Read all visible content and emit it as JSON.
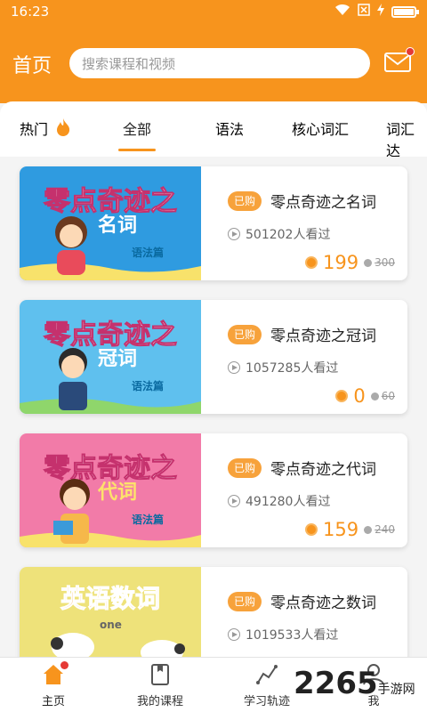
{
  "status_bar": {
    "time": "16:23"
  },
  "header": {
    "title": "首页",
    "search_placeholder": "搜索课程和视频"
  },
  "tabs": [
    {
      "label": "热门",
      "flame": true
    },
    {
      "label": "全部",
      "active": true
    },
    {
      "label": "语法"
    },
    {
      "label": "核心词汇"
    },
    {
      "label": "词汇达"
    }
  ],
  "courses": [
    {
      "badge": "已购",
      "title": "零点奇迹之名词",
      "views": "501202人看过",
      "price": "199",
      "old_price": "300",
      "thumb": {
        "title": "零点奇迹之",
        "subtitle": "名词",
        "tag": "语法篇",
        "bg": "#2f9be0"
      }
    },
    {
      "badge": "已购",
      "title": "零点奇迹之冠词",
      "views": "1057285人看过",
      "price": "0",
      "old_price": "60",
      "thumb": {
        "title": "零点奇迹之",
        "subtitle": "冠词",
        "tag": "语法篇",
        "bg": "#5fc0ee"
      }
    },
    {
      "badge": "已购",
      "title": "零点奇迹之代词",
      "views": "491280人看过",
      "price": "159",
      "old_price": "240",
      "thumb": {
        "title": "零点奇迹之",
        "subtitle": "代词",
        "tag": "语法篇",
        "bg": "#f27ba8"
      }
    },
    {
      "badge": "已购",
      "title": "零点奇迹之数词",
      "views": "1019533人看过",
      "price": "",
      "old_price": "",
      "thumb": {
        "title": "英语数词",
        "subtitle": "",
        "tag": "one",
        "bg": "#eee27a"
      }
    }
  ],
  "bottom_nav": [
    {
      "label": "主页",
      "icon": "home-icon",
      "active": true
    },
    {
      "label": "我的课程",
      "icon": "book-icon"
    },
    {
      "label": "学习轨迹",
      "icon": "track-icon"
    },
    {
      "label": "我",
      "icon": "user-icon"
    }
  ],
  "watermark": {
    "brand": "2265",
    "site": "手游网"
  },
  "colors": {
    "accent": "#f7941d",
    "badge": "#f7a23b",
    "notify": "#e53935"
  }
}
